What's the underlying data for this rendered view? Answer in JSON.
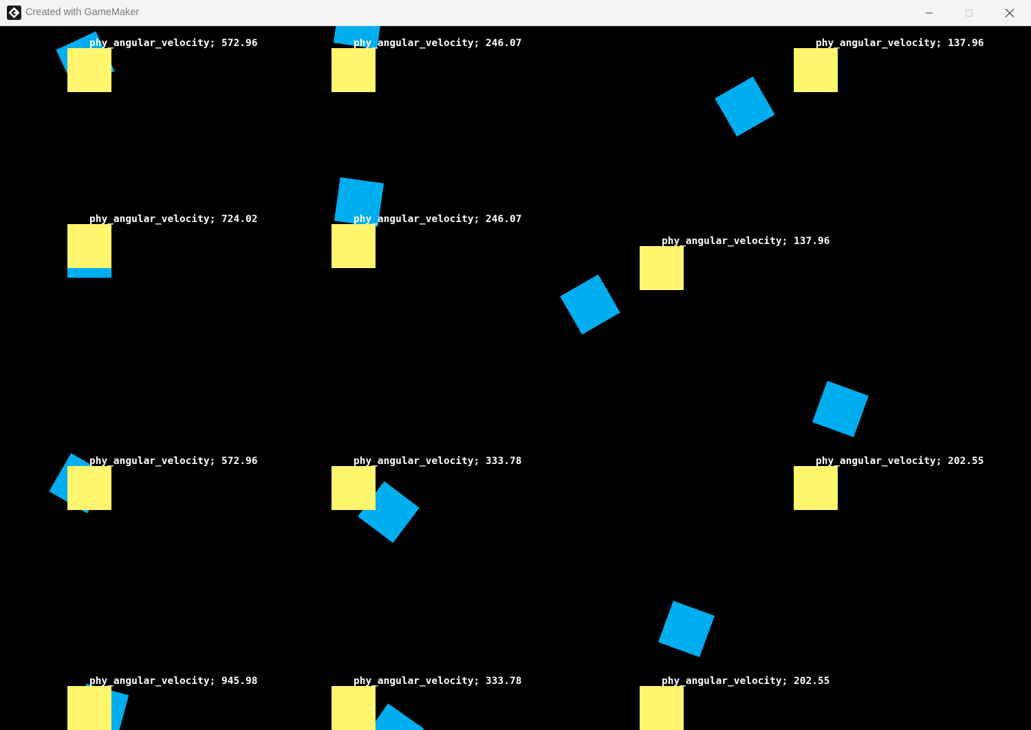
{
  "window": {
    "title": "Created with GameMaker",
    "icon": "gamemaker-logo-icon",
    "controls": {
      "minimize_icon": "minimize-icon",
      "maximize_icon": "maximize-icon",
      "close_icon": "close-icon"
    }
  },
  "colors": {
    "background": "#000000",
    "yellow_block": "#fff56e",
    "blue_block": "#00aeef",
    "label_text": "#ffffff"
  },
  "labels": [
    {
      "text": "phy_angular_velocity; 572.96"
    },
    {
      "text": "phy_angular_velocity; 246.07"
    },
    {
      "text": "phy_angular_velocity; 137.96"
    },
    {
      "text": "phy_angular_velocity; 724.02"
    },
    {
      "text": "phy_angular_velocity; 246.07"
    },
    {
      "text": "phy_angular_velocity; 137.96"
    },
    {
      "text": "phy_angular_velocity; 572.96"
    },
    {
      "text": "phy_angular_velocity; 333.78"
    },
    {
      "text": "phy_angular_velocity; 202.55"
    },
    {
      "text": "phy_angular_velocity; 945.98"
    },
    {
      "text": "phy_angular_velocity; 333.78"
    },
    {
      "text": "phy_angular_velocity; 202.55"
    }
  ]
}
